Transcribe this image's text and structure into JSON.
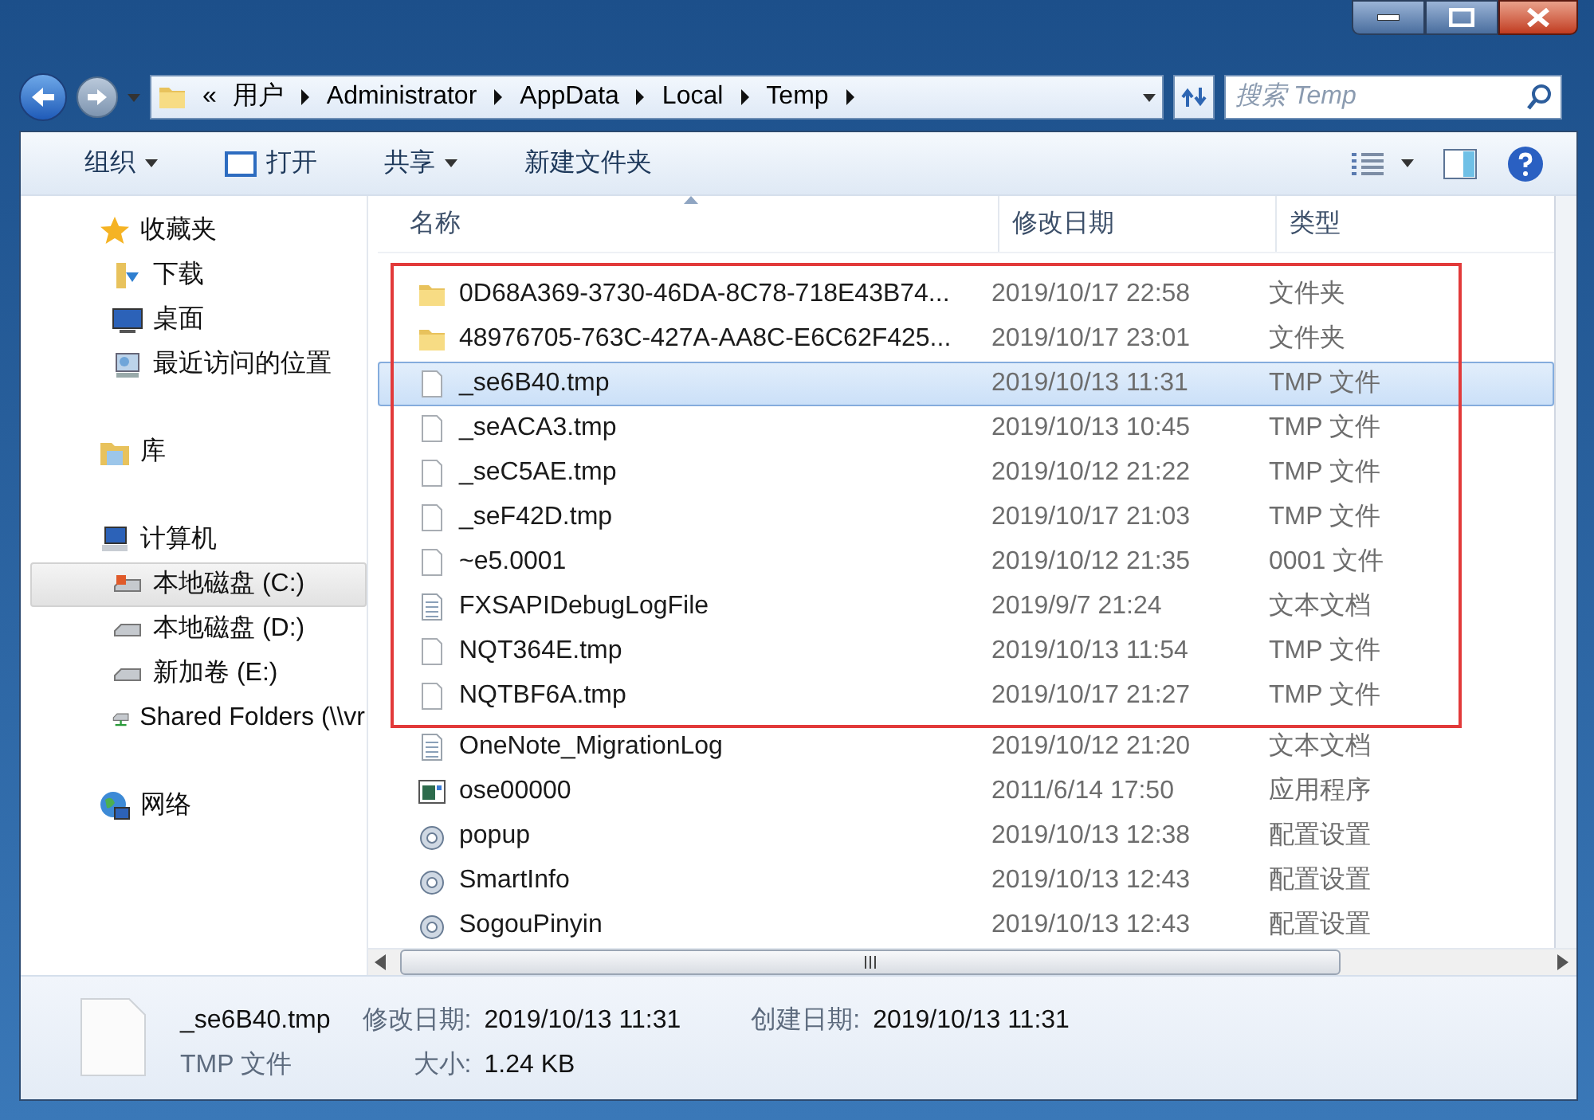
{
  "address_bar": {
    "overflow": "«",
    "segments": [
      "用户",
      "Administrator",
      "AppData",
      "Local",
      "Temp"
    ]
  },
  "search": {
    "placeholder": "搜索 Temp"
  },
  "toolbar": [
    {
      "label": "组织",
      "kind": "menu"
    },
    {
      "label": "打开",
      "kind": "open"
    },
    {
      "label": "共享",
      "kind": "menu"
    },
    {
      "label": "新建文件夹",
      "kind": "plain"
    }
  ],
  "sidebar": [
    {
      "label": "收藏夹",
      "kind": "favorites",
      "selected": false,
      "children": [
        {
          "label": "下载",
          "kind": "downloads",
          "selected": false
        },
        {
          "label": "桌面",
          "kind": "desktop",
          "selected": false
        },
        {
          "label": "最近访问的位置",
          "kind": "recent",
          "selected": false
        }
      ]
    },
    {
      "label": "库",
      "kind": "library",
      "selected": false
    },
    {
      "label": "计算机",
      "kind": "computer",
      "selected": false,
      "children": [
        {
          "label": "本地磁盘 (C:)",
          "kind": "system",
          "selected": true
        },
        {
          "label": "本地磁盘 (D:)",
          "kind": "drive",
          "selected": false
        },
        {
          "label": "新加卷 (E:)",
          "kind": "drive",
          "selected": false
        },
        {
          "label": "Shared Folders (\\\\vr",
          "kind": "share",
          "selected": false
        }
      ]
    },
    {
      "label": "网络",
      "kind": "network",
      "selected": false
    }
  ],
  "table": {
    "columns": [
      "名称",
      "修改日期",
      "类型"
    ],
    "rows": [
      {
        "name": "0D68A369-3730-46DA-8C78-718E43B74...",
        "modified": "2019/10/17 22:58",
        "type": "文件夹",
        "kind": "folder",
        "selected": false,
        "highlighted": true
      },
      {
        "name": "48976705-763C-427A-AA8C-E6C62F425...",
        "modified": "2019/10/17 23:01",
        "type": "文件夹",
        "kind": "folder",
        "selected": false,
        "highlighted": true
      },
      {
        "name": "_se6B40.tmp",
        "modified": "2019/10/13 11:31",
        "type": "TMP 文件",
        "kind": "file",
        "selected": true,
        "highlighted": true
      },
      {
        "name": "_seACA3.tmp",
        "modified": "2019/10/13 10:45",
        "type": "TMP 文件",
        "kind": "file",
        "selected": false,
        "highlighted": true
      },
      {
        "name": "_seC5AE.tmp",
        "modified": "2019/10/12 21:22",
        "type": "TMP 文件",
        "kind": "file",
        "selected": false,
        "highlighted": true
      },
      {
        "name": "_seF42D.tmp",
        "modified": "2019/10/17 21:03",
        "type": "TMP 文件",
        "kind": "file",
        "selected": false,
        "highlighted": true
      },
      {
        "name": "~e5.0001",
        "modified": "2019/10/12 21:35",
        "type": "0001 文件",
        "kind": "file",
        "selected": false,
        "highlighted": true
      },
      {
        "name": "FXSAPIDebugLogFile",
        "modified": "2019/9/7 21:24",
        "type": "文本文档",
        "kind": "text",
        "selected": false,
        "highlighted": true
      },
      {
        "name": "NQT364E.tmp",
        "modified": "2019/10/13 11:54",
        "type": "TMP 文件",
        "kind": "file",
        "selected": false,
        "highlighted": true
      },
      {
        "name": "NQTBF6A.tmp",
        "modified": "2019/10/17 21:27",
        "type": "TMP 文件",
        "kind": "file",
        "selected": false,
        "highlighted": true
      },
      {
        "name": "OneNote_MigrationLog",
        "modified": "2019/10/12 21:20",
        "type": "文本文档",
        "kind": "text",
        "selected": false,
        "highlighted": false
      },
      {
        "name": "ose00000",
        "modified": "2011/6/14 17:50",
        "type": "应用程序",
        "kind": "app",
        "selected": false,
        "highlighted": false
      },
      {
        "name": "popup",
        "modified": "2019/10/13 12:38",
        "type": "配置设置",
        "kind": "config",
        "selected": false,
        "highlighted": false
      },
      {
        "name": "SmartInfo",
        "modified": "2019/10/13 12:43",
        "type": "配置设置",
        "kind": "config",
        "selected": false,
        "highlighted": false
      },
      {
        "name": "SogouPinyin",
        "modified": "2019/10/13 12:43",
        "type": "配置设置",
        "kind": "config",
        "selected": false,
        "highlighted": false
      }
    ]
  },
  "details": {
    "name": "_se6B40.tmp",
    "type": "TMP 文件",
    "fields": [
      {
        "label": "修改日期:",
        "value": "2019/10/13 11:31"
      },
      {
        "label": "创建日期:",
        "value": "2019/10/13 11:31"
      },
      {
        "label": "大小:",
        "value": "1.24 KB"
      }
    ]
  }
}
